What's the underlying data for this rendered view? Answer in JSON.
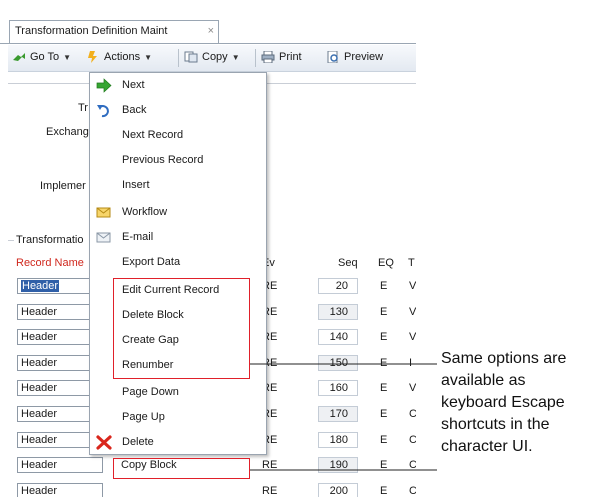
{
  "tab": {
    "title": "Transformation Definition Maint",
    "close": "×"
  },
  "toolbar": {
    "goto": "Go To",
    "actions": "Actions",
    "copy": "Copy",
    "print": "Print",
    "preview": "Preview"
  },
  "form": {
    "labels": [
      "Tr",
      "Exchang",
      "Implemer"
    ],
    "section": "Transformatio",
    "record_name_header": "Record Name"
  },
  "grid": {
    "columns": [
      "Ev",
      "Seq",
      "EQ",
      "T"
    ],
    "rows": [
      {
        "name": "Header",
        "ev": "RE",
        "seq": "20",
        "eq": "E",
        "t": "V"
      },
      {
        "name": "Header",
        "ev": "RE",
        "seq": "130",
        "eq": "E",
        "t": "V"
      },
      {
        "name": "Header",
        "ev": "RE",
        "seq": "140",
        "eq": "E",
        "t": "V"
      },
      {
        "name": "Header",
        "ev": "RE",
        "seq": "150",
        "eq": "E",
        "t": "I"
      },
      {
        "name": "Header",
        "ev": "RE",
        "seq": "160",
        "eq": "E",
        "t": "V"
      },
      {
        "name": "Header",
        "ev": "RE",
        "seq": "170",
        "eq": "E",
        "t": "C"
      },
      {
        "name": "Header",
        "ev": "RE",
        "seq": "180",
        "eq": "E",
        "t": "C"
      },
      {
        "name": "Header",
        "ev": "RE",
        "seq": "190",
        "eq": "E",
        "t": "C"
      },
      {
        "name": "Header",
        "ev": "RE",
        "seq": "200",
        "eq": "E",
        "t": "C"
      }
    ]
  },
  "menu": {
    "items": [
      {
        "label": "Next",
        "icon": "green-arrow-right-icon"
      },
      {
        "label": "Back",
        "icon": "undo-arrow-icon"
      },
      {
        "label": "Next Record",
        "icon": ""
      },
      {
        "label": "Previous Record",
        "icon": ""
      },
      {
        "label": "Insert",
        "icon": ""
      },
      {
        "label": "Workflow",
        "icon": "envelope-workflow-icon"
      },
      {
        "label": "E-mail",
        "icon": "email-icon"
      },
      {
        "label": "Export Data",
        "icon": ""
      },
      {
        "label": "Edit Current Record",
        "icon": ""
      },
      {
        "label": "Delete Block",
        "icon": ""
      },
      {
        "label": "Create Gap",
        "icon": ""
      },
      {
        "label": "Renumber",
        "icon": ""
      },
      {
        "label": "Page Down",
        "icon": ""
      },
      {
        "label": "Page Up",
        "icon": ""
      },
      {
        "label": "Delete",
        "icon": "red-x-delete-icon"
      },
      {
        "label": "Copy Block",
        "icon": ""
      }
    ]
  },
  "callout": {
    "lines": [
      "Same options are",
      "available as",
      "keyboard Escape",
      "shortcuts in the",
      "character UI."
    ],
    "color": "#e0202a"
  }
}
